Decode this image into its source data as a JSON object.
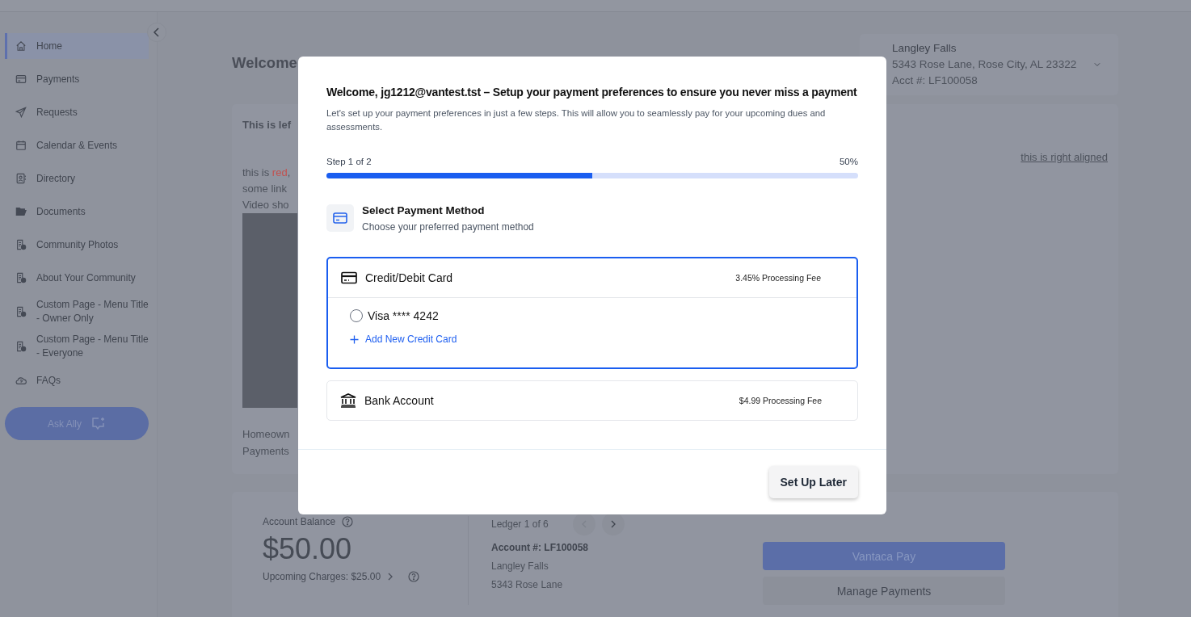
{
  "sidebar": {
    "items": [
      {
        "label": "Home",
        "selected": true
      },
      {
        "label": "Payments",
        "selected": false
      },
      {
        "label": "Requests",
        "selected": false
      },
      {
        "label": "Calendar & Events",
        "selected": false
      },
      {
        "label": "Directory",
        "selected": false
      },
      {
        "label": "Documents",
        "selected": false
      },
      {
        "label": "Community Photos",
        "selected": false
      },
      {
        "label": "About Your Community",
        "selected": false
      },
      {
        "label": "Custom Page - Menu Title - Owner Only",
        "selected": false
      },
      {
        "label": "Custom Page - Menu Title - Everyone",
        "selected": false
      },
      {
        "label": "FAQs",
        "selected": false
      }
    ],
    "ask_button": {
      "label": "Ask Ally"
    }
  },
  "page": {
    "heading": "Welcome",
    "property": {
      "name": "Langley Falls",
      "address": "5343 Rose Lane, Rose City, AL 23322",
      "account": "Acct #: LF100058"
    },
    "content_card": {
      "title": "This is lef",
      "right_link": "this is right aligned",
      "lines": [
        [
          {
            "text": "this is "
          },
          {
            "text": "red",
            "color": "#c2514f"
          },
          {
            "text": ","
          }
        ],
        [
          {
            "text": "some link"
          }
        ],
        [
          {
            "text": "Video sho"
          }
        ]
      ],
      "caption": [
        "Homeown",
        "Payments"
      ]
    },
    "account": {
      "balance_label": "Account Balance",
      "balance": "$50.00",
      "upcoming": "Upcoming Charges: $25.00",
      "ledger": "Ledger 1 of 6",
      "account_number": "Account #: LF100058",
      "community": "Langley Falls",
      "street": "5343 Rose Lane",
      "pay_button": "Vantaca Pay",
      "manage_button": "Manage Payments"
    }
  },
  "modal": {
    "title": "Welcome, jg1212@vantest.tst – Setup your payment preferences to ensure you never miss a payment",
    "intro": "Let's set up your payment preferences in just a few steps. This will allow you to seamlessly pay for your upcoming dues and assessments.",
    "step_label": "Step 1 of 2",
    "percent": "50%",
    "level": 0.5,
    "section_title": "Select Payment Method",
    "section_subtitle": "Choose your preferred payment method",
    "methods": [
      {
        "kind": "card",
        "name": "Credit/Debit Card",
        "fee": "3.45% Processing Fee",
        "selected": true,
        "saved": [
          {
            "label": "Visa **** 4242",
            "selected": false
          }
        ],
        "add_link": "Add New Credit Card"
      },
      {
        "kind": "bank",
        "name": "Bank Account",
        "fee": "$4.99 Processing Fee",
        "selected": false
      }
    ],
    "later_button": "Set Up Later"
  }
}
